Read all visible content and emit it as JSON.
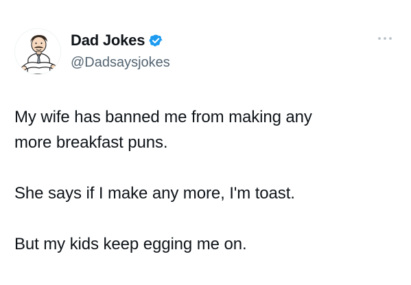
{
  "author": {
    "display_name": "Dad Jokes",
    "handle": "@Dadsaysjokes",
    "verified": true,
    "avatar_icon": "dad-cartoon-avatar-icon"
  },
  "tweet": {
    "paragraphs": [
      "My wife has banned me from making any\nmore breakfast puns.",
      "She says if I make any more, I'm toast.",
      "But my kids keep egging me on."
    ]
  },
  "icons": {
    "verified": "verified-badge-icon",
    "more": "more-options-icon"
  },
  "colors": {
    "text_primary": "#0f1419",
    "text_secondary": "#536471",
    "verified_blue": "#1d9bf0",
    "background": "#ffffff"
  }
}
